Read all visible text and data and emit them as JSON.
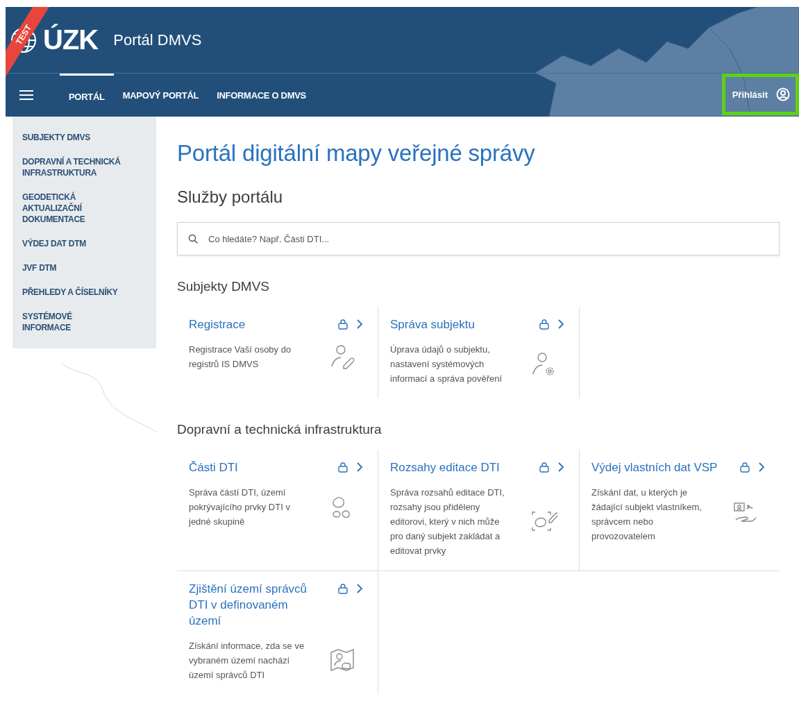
{
  "header": {
    "badge": "TEST",
    "logo": "ÚZK",
    "title": "Portál DMVS",
    "nav": [
      {
        "label": "PORTÁL",
        "selected": true
      },
      {
        "label": "MAPOVÝ PORTÁL",
        "selected": false
      },
      {
        "label": "INFORMACE O DMVS",
        "selected": false
      }
    ],
    "login": {
      "label": "Přihlásit",
      "highlighted": true
    }
  },
  "sidebar": {
    "items": [
      "SUBJEKTY DMVS",
      "DOPRAVNÍ A TECHNICKÁ INFRASTRUKTURA",
      "GEODETICKÁ AKTUALIZAČNÍ DOKUMENTACE",
      "VÝDEJ DAT DTM",
      "JVF DTM",
      "PŘEHLEDY A ČÍSELNÍKY",
      "SYSTÉMOVÉ INFORMACE"
    ]
  },
  "page_title": "Portál digitální mapy veřejné správy",
  "services_heading": "Služby portálu",
  "search": {
    "placeholder": "Co hledáte? Např. Části DTI..."
  },
  "sections": [
    {
      "title": "Subjekty DMVS",
      "cards": [
        {
          "title": "Registrace",
          "description": "Registrace Vaší osoby do registrů IS DMVS",
          "locked": true,
          "kind": "person-pencil"
        },
        {
          "title": "Správa subjektu",
          "description": "Úprava údajů o subjektu, nastavení systémových informací a správa pověření",
          "locked": true,
          "kind": "person-gear"
        }
      ]
    },
    {
      "title": "Dopravní a technická infrastruktura",
      "cards": [
        {
          "title": "Části DTI",
          "description": "Správa částí DTI, území pokrývajícího prvky DTI v jedné skupině",
          "locked": true,
          "kind": "blobs"
        },
        {
          "title": "Rozsahy editace DTI",
          "description": "Správa rozsahů editace DTI, rozsahy jsou přiděleny editorovi, který v nich může pro daný subjekt zakládat a editovat prvky",
          "locked": true,
          "kind": "blob-pencil"
        },
        {
          "title": "Výdej vlastních dat VSP",
          "description": "Získání dat, u kterých je žádající subjekt vlastníkem, správcem nebo provozovatelem",
          "locked": true,
          "kind": "hand-screen"
        },
        {
          "title": "Zjištění území správců DTI v definovaném území",
          "description": "Získání informace, zda se ve vybraném území nachází území správců DTI",
          "locked": true,
          "kind": "map-person"
        }
      ]
    }
  ]
}
